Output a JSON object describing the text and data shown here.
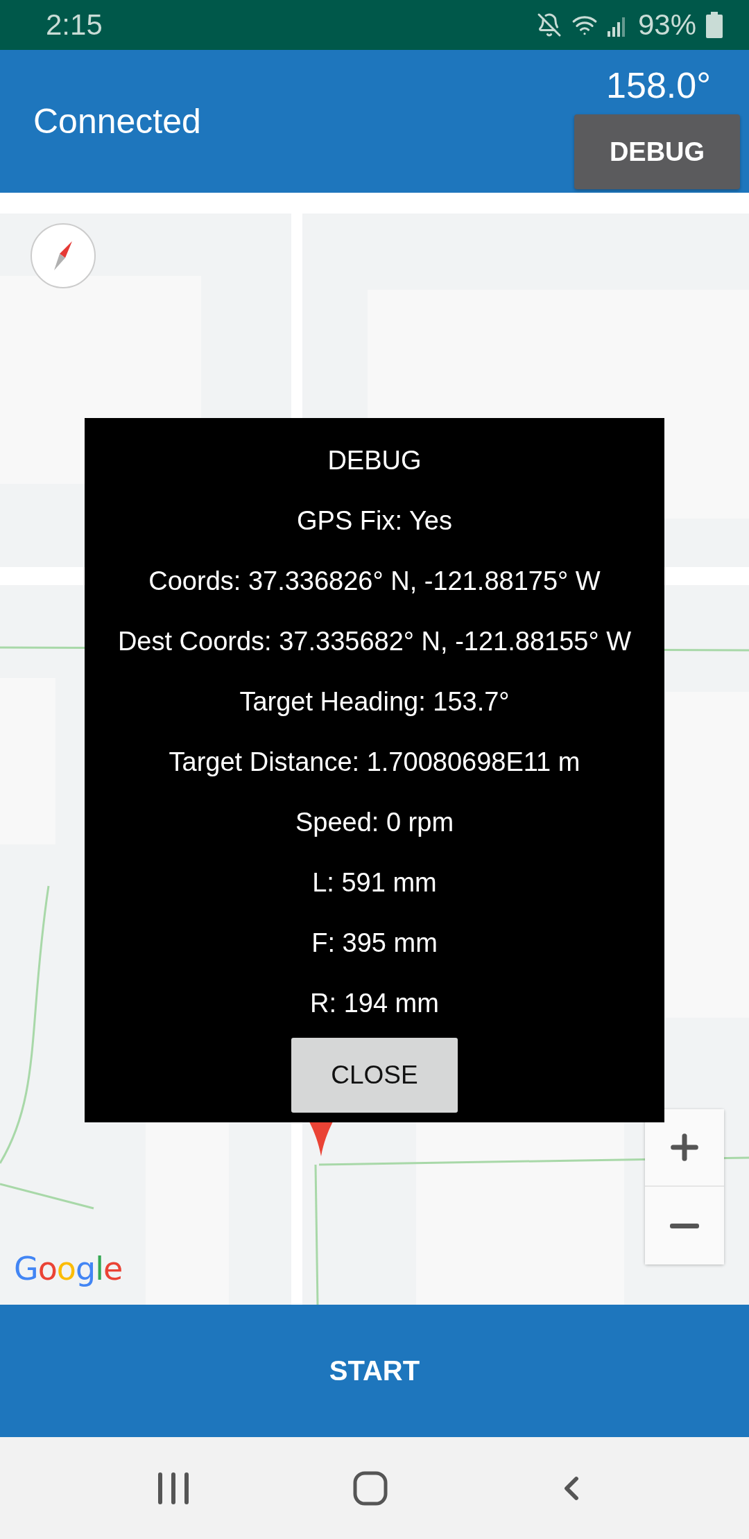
{
  "status_bar": {
    "time": "2:15",
    "battery": "93%"
  },
  "header": {
    "status": "Connected",
    "heading": "158.0°",
    "debug_button": "DEBUG"
  },
  "map": {
    "kind": "picture",
    "attribution": "Google"
  },
  "debug_dialog": {
    "title": "DEBUG",
    "lines": [
      "GPS Fix: Yes",
      "Coords: 37.336826° N, -121.88175° W",
      "Dest Coords: 37.335682° N, -121.88155° W",
      "Target Heading: 153.7°",
      "Target Distance: 1.70080698E11 m",
      "Speed: 0 rpm",
      "L: 591 mm",
      "F: 395 mm",
      "R: 194 mm"
    ],
    "close_button": "CLOSE"
  },
  "start_button": "START"
}
